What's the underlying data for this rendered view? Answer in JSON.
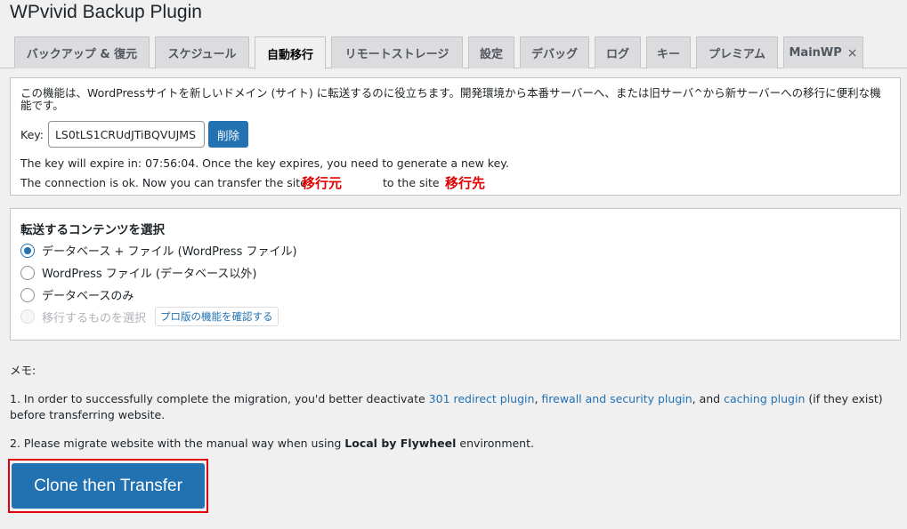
{
  "page_title": "WPvivid Backup Plugin",
  "tabs": [
    {
      "label": "バックアップ & 復元"
    },
    {
      "label": "スケジュール"
    },
    {
      "label": "自動移行"
    },
    {
      "label": "リモートストレージ"
    },
    {
      "label": "設定"
    },
    {
      "label": "デバッグ"
    },
    {
      "label": "ログ"
    },
    {
      "label": "キー"
    },
    {
      "label": "プレミアム"
    },
    {
      "label": "MainWP",
      "close": "×"
    }
  ],
  "active_tab": "自動移行",
  "transfer": {
    "description": "この機能は、WordPressサイトを新しいドメイン (サイト) に転送するのに役立ちます。開発環境から本番サーバーへ、または旧サーバ^から新サーバーへの移行に便利な機能です。",
    "key_label": "Key:",
    "key_value": "LS0tLS1CRUdJTiBQVUJMS",
    "delete_label": "削除",
    "expire_text": "The key will expire in: 07:56:04. Once the key expires, you need to generate a new key.",
    "connection_text_a": "The connection is ok. Now you can transfer the site",
    "source_label": "移行元",
    "connection_text_b": "to the site",
    "dest_label": "移行先"
  },
  "content_select": {
    "title": "転送するコンテンツを選択",
    "options": [
      {
        "label": "データベース + ファイル (WordPress ファイル)",
        "checked": true
      },
      {
        "label": "WordPress ファイル (データベース以外)",
        "checked": false
      },
      {
        "label": "データベースのみ",
        "checked": false
      },
      {
        "label": "移行するものを選択",
        "checked": false,
        "disabled": true
      }
    ],
    "pro_link": "プロ版の機能を確認する"
  },
  "notes": {
    "heading": "メモ:",
    "n1_a": "1. In order to successfully complete the migration, you'd better deactivate ",
    "n1_link1": "301 redirect plugin",
    "n1_sep1": ", ",
    "n1_link2": "firewall and security plugin",
    "n1_sep2": ", and ",
    "n1_link3": "caching plugin",
    "n1_b": " (if they exist) before transferring website.",
    "n2_a": "2. Please migrate website with the manual way when using ",
    "n2_bold": "Local by Flywheel",
    "n2_b": " environment."
  },
  "clone_button": "Clone then Transfer",
  "colors": {
    "accent": "#2271b1",
    "highlight": "#e00000"
  }
}
